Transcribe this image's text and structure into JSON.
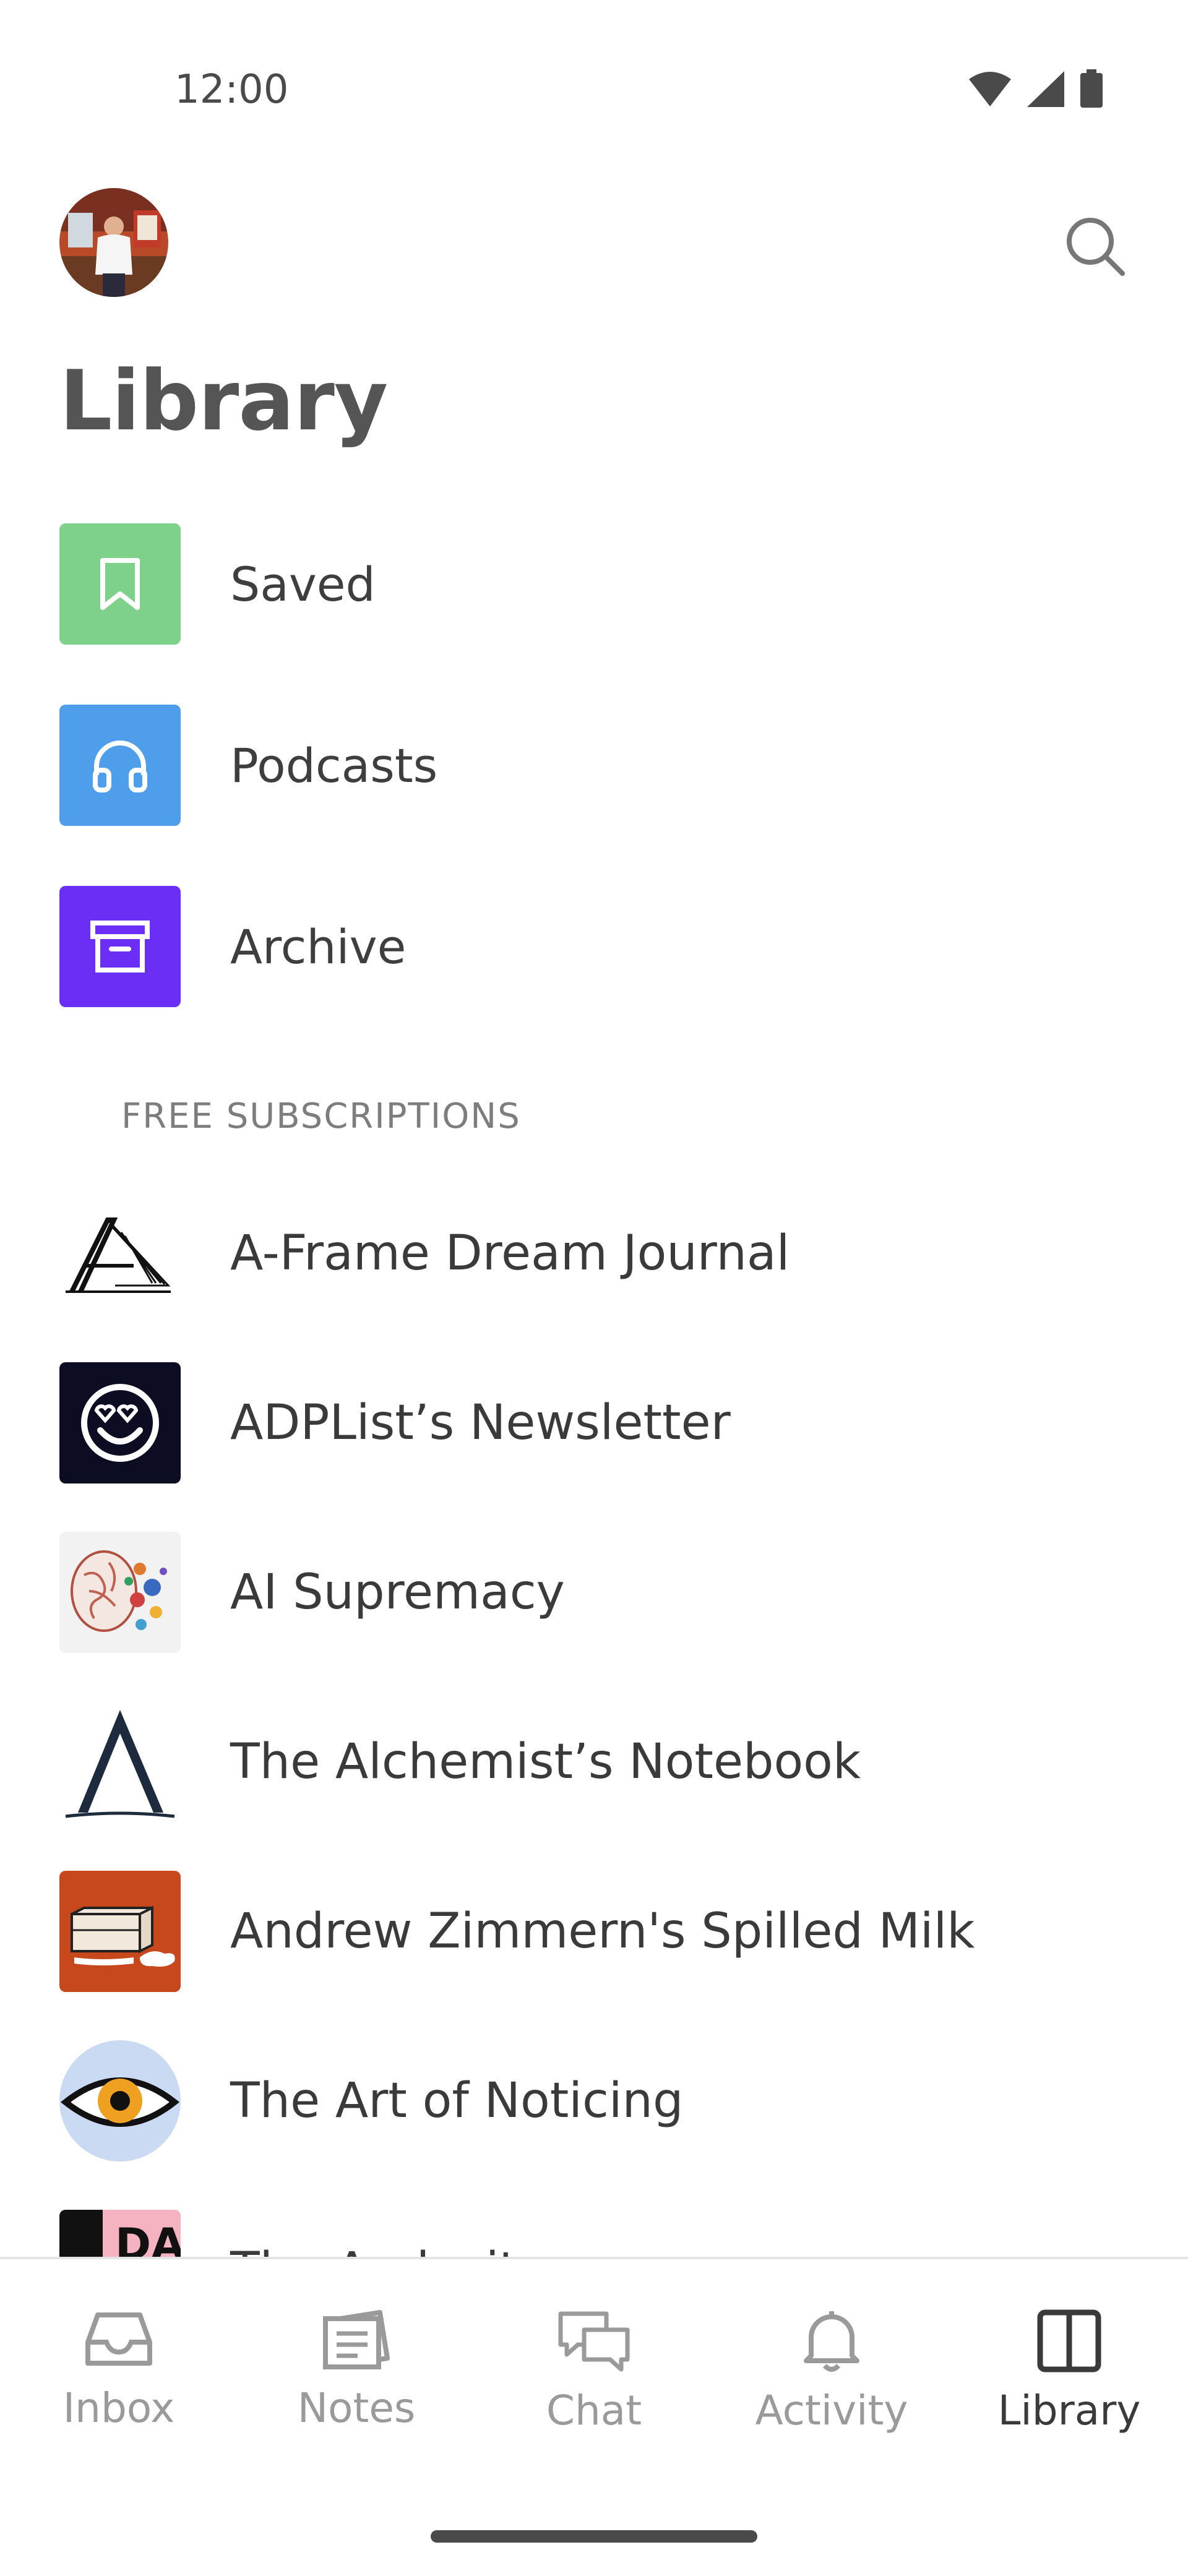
{
  "status_bar": {
    "time": "12:00",
    "icons": [
      "wifi-icon",
      "signal-icon",
      "battery-icon"
    ]
  },
  "header": {
    "avatar": "avatar",
    "search_icon": "search-icon",
    "title": "Library"
  },
  "library_items": [
    {
      "label": "Saved",
      "icon": "bookmark-icon",
      "color": "#7ED18B"
    },
    {
      "label": "Podcasts",
      "icon": "headphones-icon",
      "color": "#4F9EEB"
    },
    {
      "label": "Archive",
      "icon": "archive-box-icon",
      "color": "#6A2EF5"
    }
  ],
  "subscriptions": {
    "section_title": "FREE SUBSCRIPTIONS",
    "items": [
      {
        "label": "A-Frame Dream Journal"
      },
      {
        "label": "ADPList’s Newsletter"
      },
      {
        "label": "AI Supremacy"
      },
      {
        "label": "The Alchemist’s Notebook"
      },
      {
        "label": "Andrew Zimmern's Spilled Milk"
      },
      {
        "label": "The Art of Noticing"
      },
      {
        "label": "The Audacity"
      }
    ]
  },
  "bottom_nav": {
    "items": [
      {
        "label": "Inbox",
        "icon": "inbox-icon"
      },
      {
        "label": "Notes",
        "icon": "notes-icon"
      },
      {
        "label": "Chat",
        "icon": "chat-icon"
      },
      {
        "label": "Activity",
        "icon": "bell-icon"
      },
      {
        "label": "Library",
        "icon": "library-icon",
        "active": true
      }
    ]
  },
  "colors": {
    "title": "#555555",
    "text": "#3a3a3a",
    "muted": "#9a9a9a"
  }
}
